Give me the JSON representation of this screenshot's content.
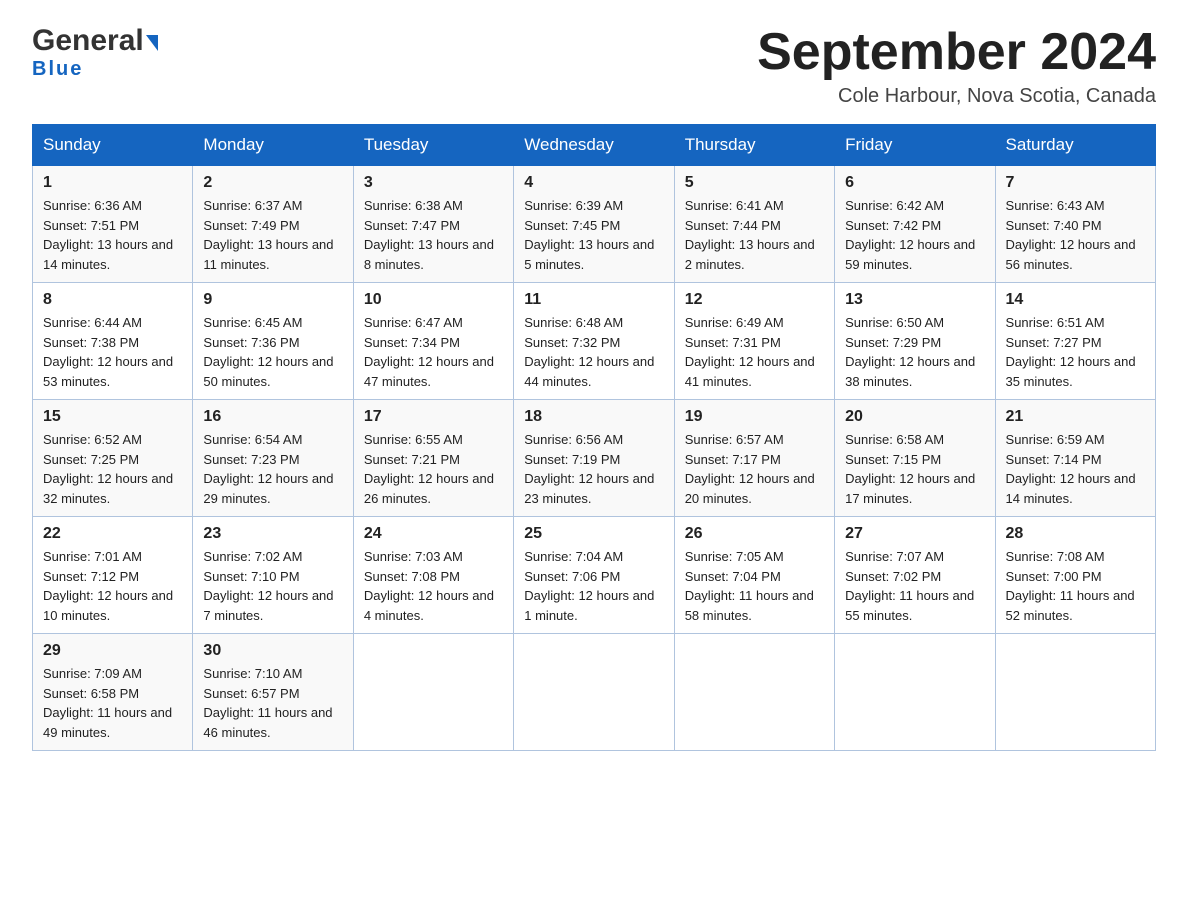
{
  "header": {
    "logo_general": "General",
    "logo_blue": "Blue",
    "month_title": "September 2024",
    "location": "Cole Harbour, Nova Scotia, Canada"
  },
  "weekdays": [
    "Sunday",
    "Monday",
    "Tuesday",
    "Wednesday",
    "Thursday",
    "Friday",
    "Saturday"
  ],
  "weeks": [
    [
      {
        "day": "1",
        "sunrise": "Sunrise: 6:36 AM",
        "sunset": "Sunset: 7:51 PM",
        "daylight": "Daylight: 13 hours and 14 minutes."
      },
      {
        "day": "2",
        "sunrise": "Sunrise: 6:37 AM",
        "sunset": "Sunset: 7:49 PM",
        "daylight": "Daylight: 13 hours and 11 minutes."
      },
      {
        "day": "3",
        "sunrise": "Sunrise: 6:38 AM",
        "sunset": "Sunset: 7:47 PM",
        "daylight": "Daylight: 13 hours and 8 minutes."
      },
      {
        "day": "4",
        "sunrise": "Sunrise: 6:39 AM",
        "sunset": "Sunset: 7:45 PM",
        "daylight": "Daylight: 13 hours and 5 minutes."
      },
      {
        "day": "5",
        "sunrise": "Sunrise: 6:41 AM",
        "sunset": "Sunset: 7:44 PM",
        "daylight": "Daylight: 13 hours and 2 minutes."
      },
      {
        "day": "6",
        "sunrise": "Sunrise: 6:42 AM",
        "sunset": "Sunset: 7:42 PM",
        "daylight": "Daylight: 12 hours and 59 minutes."
      },
      {
        "day": "7",
        "sunrise": "Sunrise: 6:43 AM",
        "sunset": "Sunset: 7:40 PM",
        "daylight": "Daylight: 12 hours and 56 minutes."
      }
    ],
    [
      {
        "day": "8",
        "sunrise": "Sunrise: 6:44 AM",
        "sunset": "Sunset: 7:38 PM",
        "daylight": "Daylight: 12 hours and 53 minutes."
      },
      {
        "day": "9",
        "sunrise": "Sunrise: 6:45 AM",
        "sunset": "Sunset: 7:36 PM",
        "daylight": "Daylight: 12 hours and 50 minutes."
      },
      {
        "day": "10",
        "sunrise": "Sunrise: 6:47 AM",
        "sunset": "Sunset: 7:34 PM",
        "daylight": "Daylight: 12 hours and 47 minutes."
      },
      {
        "day": "11",
        "sunrise": "Sunrise: 6:48 AM",
        "sunset": "Sunset: 7:32 PM",
        "daylight": "Daylight: 12 hours and 44 minutes."
      },
      {
        "day": "12",
        "sunrise": "Sunrise: 6:49 AM",
        "sunset": "Sunset: 7:31 PM",
        "daylight": "Daylight: 12 hours and 41 minutes."
      },
      {
        "day": "13",
        "sunrise": "Sunrise: 6:50 AM",
        "sunset": "Sunset: 7:29 PM",
        "daylight": "Daylight: 12 hours and 38 minutes."
      },
      {
        "day": "14",
        "sunrise": "Sunrise: 6:51 AM",
        "sunset": "Sunset: 7:27 PM",
        "daylight": "Daylight: 12 hours and 35 minutes."
      }
    ],
    [
      {
        "day": "15",
        "sunrise": "Sunrise: 6:52 AM",
        "sunset": "Sunset: 7:25 PM",
        "daylight": "Daylight: 12 hours and 32 minutes."
      },
      {
        "day": "16",
        "sunrise": "Sunrise: 6:54 AM",
        "sunset": "Sunset: 7:23 PM",
        "daylight": "Daylight: 12 hours and 29 minutes."
      },
      {
        "day": "17",
        "sunrise": "Sunrise: 6:55 AM",
        "sunset": "Sunset: 7:21 PM",
        "daylight": "Daylight: 12 hours and 26 minutes."
      },
      {
        "day": "18",
        "sunrise": "Sunrise: 6:56 AM",
        "sunset": "Sunset: 7:19 PM",
        "daylight": "Daylight: 12 hours and 23 minutes."
      },
      {
        "day": "19",
        "sunrise": "Sunrise: 6:57 AM",
        "sunset": "Sunset: 7:17 PM",
        "daylight": "Daylight: 12 hours and 20 minutes."
      },
      {
        "day": "20",
        "sunrise": "Sunrise: 6:58 AM",
        "sunset": "Sunset: 7:15 PM",
        "daylight": "Daylight: 12 hours and 17 minutes."
      },
      {
        "day": "21",
        "sunrise": "Sunrise: 6:59 AM",
        "sunset": "Sunset: 7:14 PM",
        "daylight": "Daylight: 12 hours and 14 minutes."
      }
    ],
    [
      {
        "day": "22",
        "sunrise": "Sunrise: 7:01 AM",
        "sunset": "Sunset: 7:12 PM",
        "daylight": "Daylight: 12 hours and 10 minutes."
      },
      {
        "day": "23",
        "sunrise": "Sunrise: 7:02 AM",
        "sunset": "Sunset: 7:10 PM",
        "daylight": "Daylight: 12 hours and 7 minutes."
      },
      {
        "day": "24",
        "sunrise": "Sunrise: 7:03 AM",
        "sunset": "Sunset: 7:08 PM",
        "daylight": "Daylight: 12 hours and 4 minutes."
      },
      {
        "day": "25",
        "sunrise": "Sunrise: 7:04 AM",
        "sunset": "Sunset: 7:06 PM",
        "daylight": "Daylight: 12 hours and 1 minute."
      },
      {
        "day": "26",
        "sunrise": "Sunrise: 7:05 AM",
        "sunset": "Sunset: 7:04 PM",
        "daylight": "Daylight: 11 hours and 58 minutes."
      },
      {
        "day": "27",
        "sunrise": "Sunrise: 7:07 AM",
        "sunset": "Sunset: 7:02 PM",
        "daylight": "Daylight: 11 hours and 55 minutes."
      },
      {
        "day": "28",
        "sunrise": "Sunrise: 7:08 AM",
        "sunset": "Sunset: 7:00 PM",
        "daylight": "Daylight: 11 hours and 52 minutes."
      }
    ],
    [
      {
        "day": "29",
        "sunrise": "Sunrise: 7:09 AM",
        "sunset": "Sunset: 6:58 PM",
        "daylight": "Daylight: 11 hours and 49 minutes."
      },
      {
        "day": "30",
        "sunrise": "Sunrise: 7:10 AM",
        "sunset": "Sunset: 6:57 PM",
        "daylight": "Daylight: 11 hours and 46 minutes."
      },
      null,
      null,
      null,
      null,
      null
    ]
  ]
}
